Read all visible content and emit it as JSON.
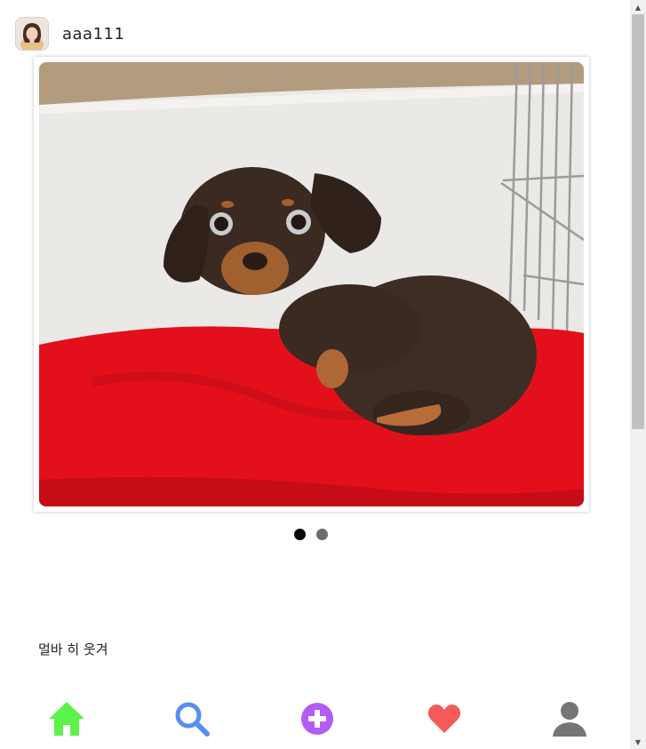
{
  "post": {
    "username": "aaa111",
    "caption": "멀바 히 웃겨",
    "image_count": 2,
    "active_image_index": 0
  },
  "nav": {
    "items": [
      {
        "name": "home",
        "icon": "home-icon",
        "color": "#5cf24a"
      },
      {
        "name": "search",
        "icon": "search-icon",
        "color": "#5a8df0"
      },
      {
        "name": "add",
        "icon": "plus-circle-icon",
        "color": "#b35cf5"
      },
      {
        "name": "likes",
        "icon": "heart-icon",
        "color": "#f55a5a"
      },
      {
        "name": "profile",
        "icon": "user-icon",
        "color": "#757575"
      }
    ]
  }
}
